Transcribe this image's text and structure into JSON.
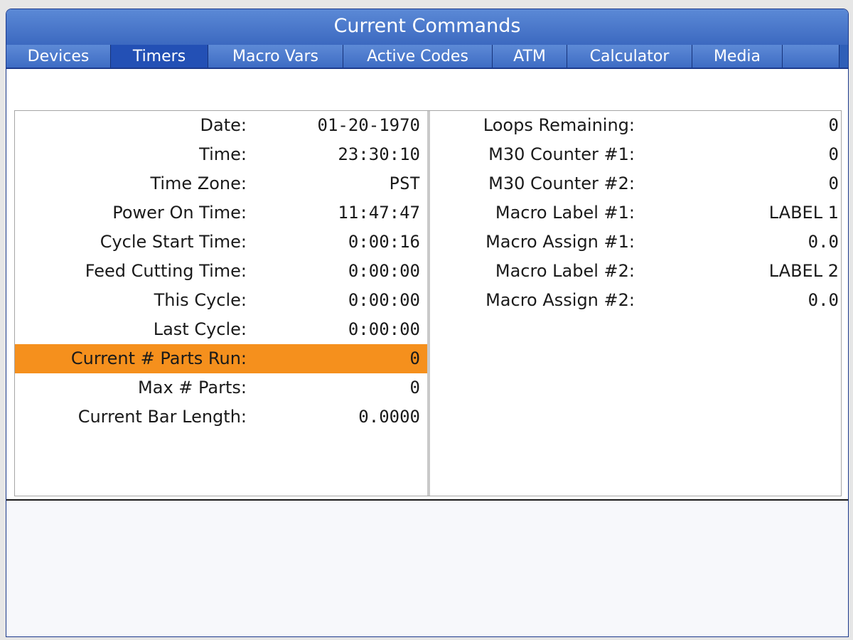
{
  "window": {
    "title": "Current Commands"
  },
  "tabs": [
    {
      "label": "Devices",
      "active": false
    },
    {
      "label": "Timers",
      "active": true
    },
    {
      "label": "Macro Vars",
      "active": false
    },
    {
      "label": "Active Codes",
      "active": false
    },
    {
      "label": "ATM",
      "active": false
    },
    {
      "label": "Calculator",
      "active": false
    },
    {
      "label": "Media",
      "active": false
    }
  ],
  "timers": [
    {
      "label": "Date:",
      "value": "01-20-1970"
    },
    {
      "label": "Time:",
      "value": "23:30:10"
    },
    {
      "label": "Time Zone:",
      "value": "PST"
    },
    {
      "label": "Power On Time:",
      "value": "11:47:47"
    },
    {
      "label": "Cycle Start Time:",
      "value": "0:00:16"
    },
    {
      "label": "Feed Cutting Time:",
      "value": "0:00:00"
    },
    {
      "label": "This Cycle:",
      "value": "0:00:00"
    },
    {
      "label": "Last Cycle:",
      "value": "0:00:00"
    },
    {
      "label": "Current # Parts Run:",
      "value": "0",
      "selected": true
    },
    {
      "label": "Max # Parts:",
      "value": "0"
    },
    {
      "label": "Current Bar Length:",
      "value": "0.0000"
    }
  ],
  "counters": [
    {
      "label": "Loops Remaining:",
      "value": "0"
    },
    {
      "label": "M30 Counter #1:",
      "value": "0"
    },
    {
      "label": "M30 Counter #2:",
      "value": "0"
    },
    {
      "label": "Macro Label #1:",
      "value": "LABEL 1"
    },
    {
      "label": "Macro Assign #1:",
      "value": "0.0"
    },
    {
      "label": "Macro Label #2:",
      "value": "LABEL 2"
    },
    {
      "label": "Macro Assign #2:",
      "value": "0.0"
    }
  ],
  "colors": {
    "title_bar": "#3c69c0",
    "tab_active": "#2350b5",
    "selection": "#f5901d",
    "border": "#1c3a8c"
  }
}
